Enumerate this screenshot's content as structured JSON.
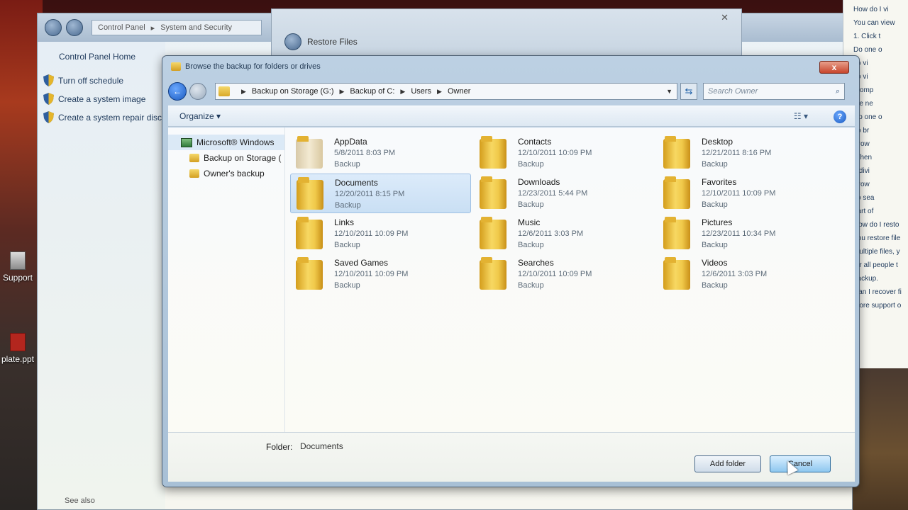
{
  "desktop": {
    "icons": [
      {
        "label": "Support"
      },
      {
        "label": "plate.ppt"
      }
    ]
  },
  "control_panel": {
    "breadcrumb": [
      "Control Panel",
      "System and Security"
    ],
    "home_link": "Control Panel Home",
    "tasks": [
      {
        "label": "Turn off schedule"
      },
      {
        "label": "Create a system image"
      },
      {
        "label": "Create a system repair disc"
      }
    ],
    "see_also": "See also"
  },
  "restore_window": {
    "title": "Restore Files"
  },
  "help_window": {
    "lines": [
      "How do I vi",
      "You can view",
      "1.  Click t",
      "Do one o",
      "To vi",
      "To vi",
      "promp",
      "the ne",
      "Do one o",
      "To br",
      "Brow",
      "When",
      "indivi",
      "Brow",
      "To sea",
      "part of",
      "How do I resto",
      "You restore file",
      "multiple files, y",
      "for all people t",
      "backup.",
      "Can I recover fi",
      "More support o"
    ]
  },
  "dialog": {
    "title": "Browse the backup for folders or drives",
    "close_label": "x",
    "address": {
      "crumbs": [
        "Backup on Storage (G:)",
        "Backup of C:",
        "Users",
        "Owner"
      ]
    },
    "search": {
      "placeholder": "Search Owner"
    },
    "toolbar": {
      "organize_label": "Organize ▾",
      "view_label": "☷ ▾",
      "help_label": "?"
    },
    "nav_tree": [
      {
        "label": "Microsoft® Windows",
        "root": true
      },
      {
        "label": "Backup on Storage (",
        "root": false
      },
      {
        "label": "Owner's backup",
        "root": false
      }
    ],
    "files": [
      {
        "name": "AppData",
        "date": "5/8/2011 8:03 PM",
        "type": "Backup"
      },
      {
        "name": "Contacts",
        "date": "12/10/2011 10:09 PM",
        "type": "Backup"
      },
      {
        "name": "Desktop",
        "date": "12/21/2011 8:16 PM",
        "type": "Backup"
      },
      {
        "name": "Documents",
        "date": "12/20/2011 8:15 PM",
        "type": "Backup"
      },
      {
        "name": "Downloads",
        "date": "12/23/2011 5:44 PM",
        "type": "Backup"
      },
      {
        "name": "Favorites",
        "date": "12/10/2011 10:09 PM",
        "type": "Backup"
      },
      {
        "name": "Links",
        "date": "12/10/2011 10:09 PM",
        "type": "Backup"
      },
      {
        "name": "Music",
        "date": "12/6/2011 3:03 PM",
        "type": "Backup"
      },
      {
        "name": "Pictures",
        "date": "12/23/2011 10:34 PM",
        "type": "Backup"
      },
      {
        "name": "Saved Games",
        "date": "12/10/2011 10:09 PM",
        "type": "Backup"
      },
      {
        "name": "Searches",
        "date": "12/10/2011 10:09 PM",
        "type": "Backup"
      },
      {
        "name": "Videos",
        "date": "12/6/2011 3:03 PM",
        "type": "Backup"
      }
    ],
    "selected_file": "Documents",
    "footer": {
      "folder_label": "Folder:",
      "folder_value": "Documents",
      "add_folder_label": "Add folder",
      "cancel_label": "Cancel"
    }
  }
}
